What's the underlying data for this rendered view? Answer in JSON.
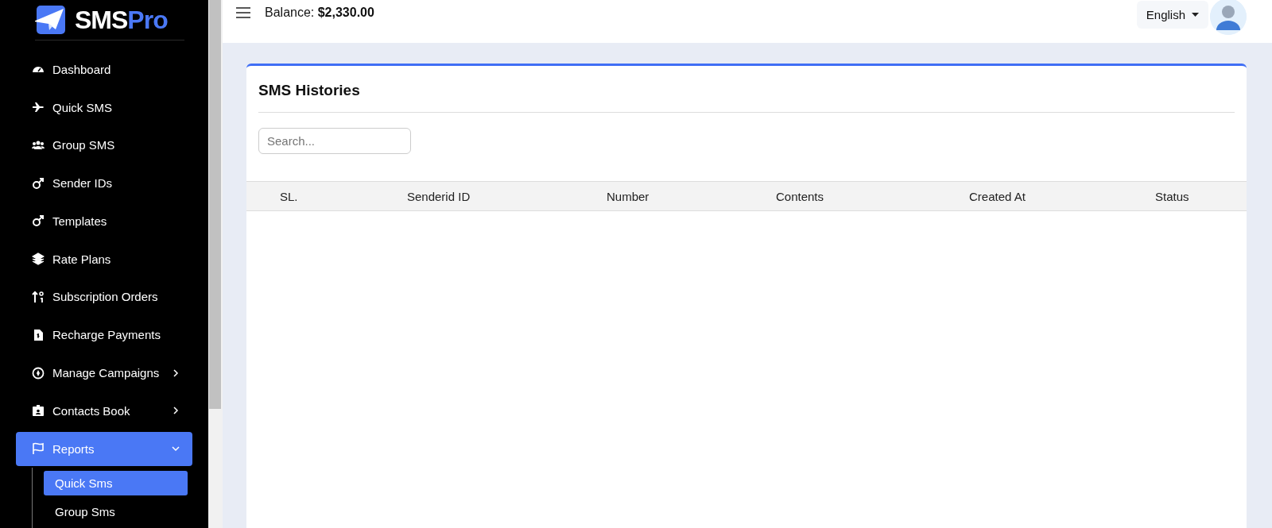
{
  "brand": {
    "name": "SMS",
    "accent": "Pro"
  },
  "header": {
    "balance": "Balance: **$2,330.00**",
    "language": "English"
  },
  "sidebar": {
    "items": [
      {
        "label": "Dashboard",
        "selected": false
      },
      {
        "label": "Quick SMS",
        "selected": false
      },
      {
        "label": "Group SMS",
        "selected": false
      },
      {
        "label": "Sender IDs",
        "selected": false
      },
      {
        "label": "Templates",
        "selected": false
      },
      {
        "label": "Rate Plans",
        "selected": false
      },
      {
        "label": "Subscription Orders",
        "selected": false
      },
      {
        "label": "Recharge Payments",
        "selected": false
      },
      {
        "label": "Manage Campaigns",
        "selected": false,
        "expanded": false
      },
      {
        "label": "Contacts Book",
        "selected": false,
        "expanded": false
      },
      {
        "label": "Reports",
        "selected": true,
        "expanded": true,
        "children": [
          {
            "label": "Quick Sms",
            "selected": true
          },
          {
            "label": "Group Sms",
            "selected": false
          }
        ]
      }
    ]
  },
  "card": {
    "title": "SMS Histories",
    "search": {
      "placeholder": "Search..."
    },
    "table": {
      "columns": [
        "SL.",
        "Senderid ID",
        "Number",
        "Contents",
        "Created At",
        "Status"
      ]
    }
  }
}
